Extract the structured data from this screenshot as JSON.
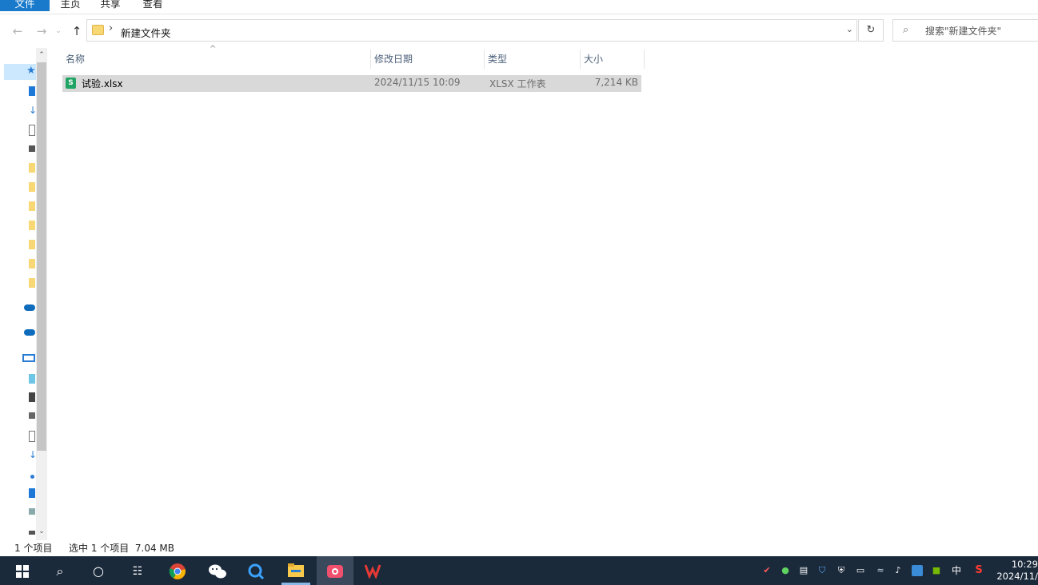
{
  "ribbon": {
    "tabs": [
      "文件",
      "主页",
      "共享",
      "查看"
    ]
  },
  "address": {
    "breadcrumb": "新建文件夹",
    "search_placeholder": "搜索\"新建文件夹\""
  },
  "columns": {
    "name": "名称",
    "modified": "修改日期",
    "type": "类型",
    "size": "大小"
  },
  "files": [
    {
      "name": "试验.xlsx",
      "modified": "2024/11/15 10:09",
      "type": "XLSX 工作表",
      "size": "7,214 KB"
    }
  ],
  "status": {
    "count": "1 个项目",
    "selection": "选中 1 个项目  7.04 MB"
  },
  "tray": {
    "ime": "中",
    "time": "10:29",
    "date": "2024/11/"
  },
  "colors": {
    "accent": "#1979ca",
    "selection": "#d9d9d9",
    "taskbar": "#1b2a3b"
  }
}
